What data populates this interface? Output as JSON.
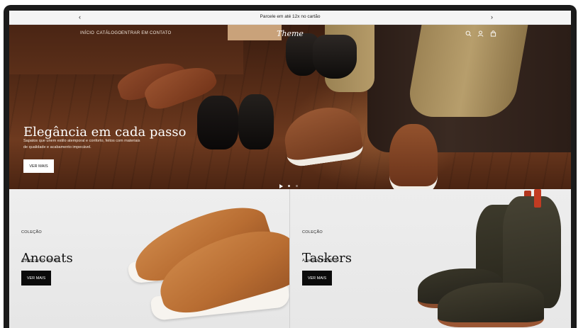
{
  "announcement": {
    "text": "Parcele em até 12x no cartão",
    "prev_icon": "‹",
    "next_icon": "›"
  },
  "nav": {
    "items": [
      "INÍCIO",
      "CATÁLOGO",
      "ENTRAR EM CONTATO"
    ],
    "logo": "Theme",
    "icons": [
      "search-icon",
      "account-icon",
      "cart-icon"
    ]
  },
  "hero": {
    "title": "Elegância em cada passo",
    "subtitle": "Sapatos que unem estilo atemporal e conforto, feitos com materiais de qualidade e acabamento impecável.",
    "button": "VER MAIS"
  },
  "collections": [
    {
      "label": "COLEÇÃO",
      "title": "Ancoats",
      "price": "A partir de R$ 305,00",
      "button": "VER MAIS"
    },
    {
      "label": "COLEÇÃO",
      "title": "Taskers",
      "price": "A partir de R$ 465,00",
      "button": "VER MAIS"
    }
  ]
}
